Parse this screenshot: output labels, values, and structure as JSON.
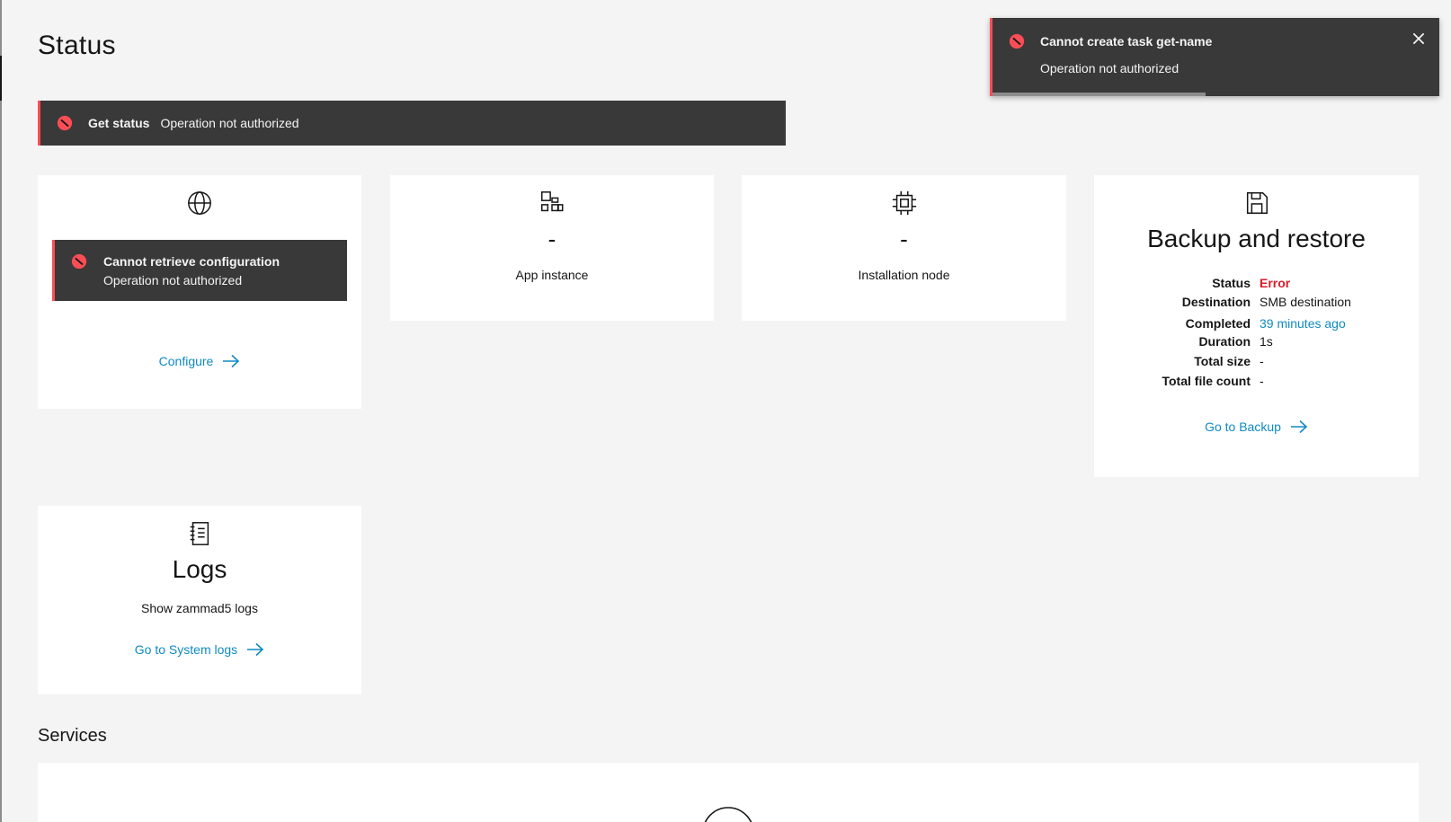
{
  "page": {
    "title": "Status"
  },
  "inline_notification": {
    "title": "Get status",
    "subtitle": "Operation not authorized"
  },
  "toast": {
    "title": "Cannot create task get-name",
    "subtitle": "Operation not authorized",
    "close_icon": "close-icon"
  },
  "network_card": {
    "icon": "globe-icon",
    "error_title": "Cannot retrieve configuration",
    "error_subtitle": "Operation not authorized",
    "link": "Configure"
  },
  "app_card": {
    "icon": "app-switcher-icon",
    "value": "-",
    "label": "App instance"
  },
  "node_card": {
    "icon": "chip-icon",
    "value": "-",
    "label": "Installation node"
  },
  "backup_card": {
    "icon": "floppy-disk-icon",
    "title": "Backup and restore",
    "rows": [
      {
        "key": "Status",
        "value": "Error"
      },
      {
        "key": "Destination",
        "value": "SMB destination"
      },
      {
        "key": "Completed",
        "value": "39 minutes ago"
      },
      {
        "key": "Duration",
        "value": "1s"
      },
      {
        "key": "Total size",
        "value": "-"
      },
      {
        "key": "Total file count",
        "value": "-"
      }
    ],
    "link": "Go to Backup"
  },
  "logs_card": {
    "icon": "notebook-icon",
    "title": "Logs",
    "description": "Show zammad5 logs",
    "link": "Go to System logs"
  },
  "services": {
    "title": "Services",
    "icon": "add-circle-icon"
  },
  "colors": {
    "error": "#da1e28",
    "error_border": "#fa4d56",
    "link": "#0f8ac5",
    "notification_bg": "#393939",
    "page_bg": "#f4f4f4"
  }
}
